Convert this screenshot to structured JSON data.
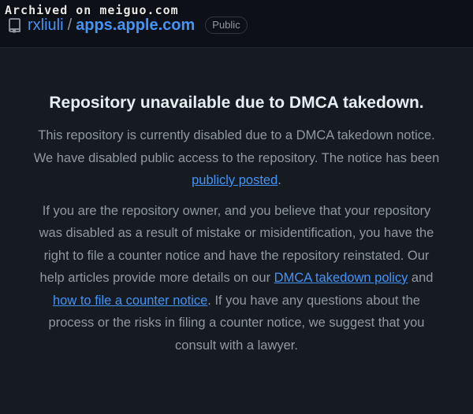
{
  "watermark": "Archived on meiguo.com",
  "repo": {
    "owner": "rxliuli",
    "separator": "/",
    "name": "apps.apple.com",
    "visibility": "Public",
    "icon": "repo-icon"
  },
  "notice": {
    "title": "Repository unavailable due to DMCA takedown.",
    "p1_text": "This repository is currently disabled due to a DMCA takedown notice. We have disabled public access to the repository. The notice has been ",
    "p1_link": "publicly posted",
    "p1_end": ".",
    "p2_text": "If you are the repository owner, and you believe that your repository was disabled as a result of mistake or misidentification, you have the right to file a counter notice and have the repository reinstated. Our help articles provide more details on our ",
    "p2_link1": "DMCA takedown policy",
    "p2_and": " and ",
    "p2_link2": "how to file a counter notice",
    "p2_end": ". If you have any questions about the process or the risks in filing a counter notice, we suggest that you consult with a lawyer."
  },
  "colors": {
    "background": "#0d1117",
    "panel": "#161b22",
    "link": "#4493f8",
    "muted_text": "#9198a1",
    "heading": "#e6edf3"
  }
}
